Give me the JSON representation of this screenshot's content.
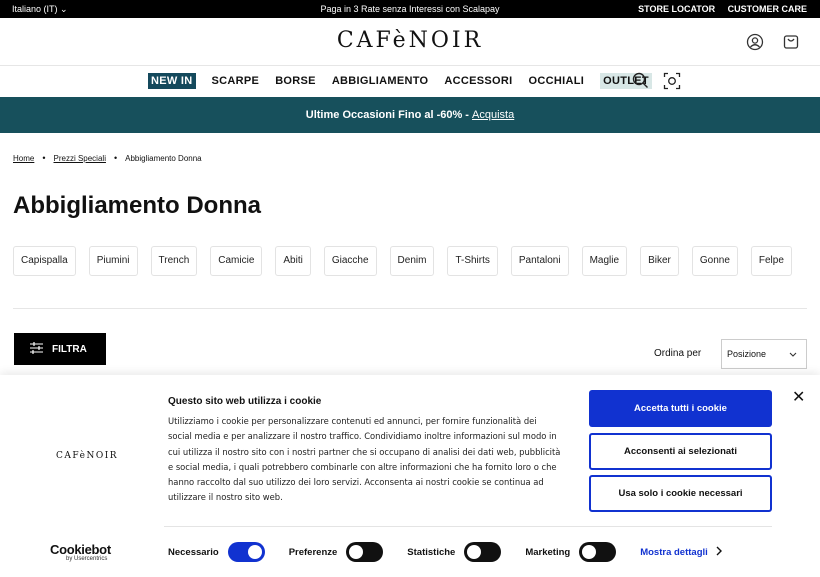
{
  "topbar": {
    "language": "Italiano (IT)",
    "promo": "Paga in 3 Rate senza Interessi con Scalapay",
    "store_locator": "STORE LOCATOR",
    "customer_care": "CUSTOMER CARE"
  },
  "header": {
    "logo": "CAFèNOIR"
  },
  "nav": {
    "items": [
      "NEW IN",
      "SCARPE",
      "BORSE",
      "ABBIGLIAMENTO",
      "ACCESSORI",
      "OCCHIALI",
      "OUTLET"
    ]
  },
  "banner": {
    "text": "Ultime Occasioni Fino al -60% - ",
    "link": "Acquista"
  },
  "breadcrumb": [
    "Home",
    "Prezzi Speciali",
    "Abbigliamento Donna"
  ],
  "page_title": "Abbigliamento Donna",
  "categories": [
    "Capispalla",
    "Piumini",
    "Trench",
    "Camicie",
    "Abiti",
    "Giacche",
    "Denim",
    "T-Shirts",
    "Pantaloni",
    "Maglie",
    "Biker",
    "Gonne",
    "Felpe"
  ],
  "filter": {
    "label": "FILTRA"
  },
  "sort": {
    "label": "Ordina per",
    "selected": "Posizione"
  },
  "cookie": {
    "logo": "CAFèNOIR",
    "title": "Questo sito web utilizza i cookie",
    "text": "Utilizziamo i cookie per personalizzare contenuti ed annunci, per fornire funzionalità dei social media e per analizzare il nostro traffico. Condividiamo inoltre informazioni sul modo in cui utilizza il nostro sito con i nostri partner che si occupano di analisi dei dati web, pubblicità e social media, i quali potrebbero combinarle con altre informazioni che ha fornito loro o che hanno raccolto dal suo utilizzo dei loro servizi. Acconsenta ai nostri cookie se continua ad utilizzare il nostro sito web.",
    "accept_all": "Accetta tutti i cookie",
    "accept_selected": "Acconsenti ai selezionati",
    "necessary_only": "Usa solo i cookie necessari",
    "close": "✕",
    "brand": "Cookiebot",
    "brand_sub": "by Usercentrics",
    "toggles": [
      {
        "label": "Necessario",
        "on": true
      },
      {
        "label": "Preferenze",
        "on": false
      },
      {
        "label": "Statistiche",
        "on": false
      },
      {
        "label": "Marketing",
        "on": false
      }
    ],
    "details": "Mostra dettagli"
  },
  "colors": {
    "accent_blue": "#1132d0",
    "banner_teal": "#17505c",
    "newin_bg": "#14495c",
    "outlet_bg": "#d8e7e6"
  }
}
